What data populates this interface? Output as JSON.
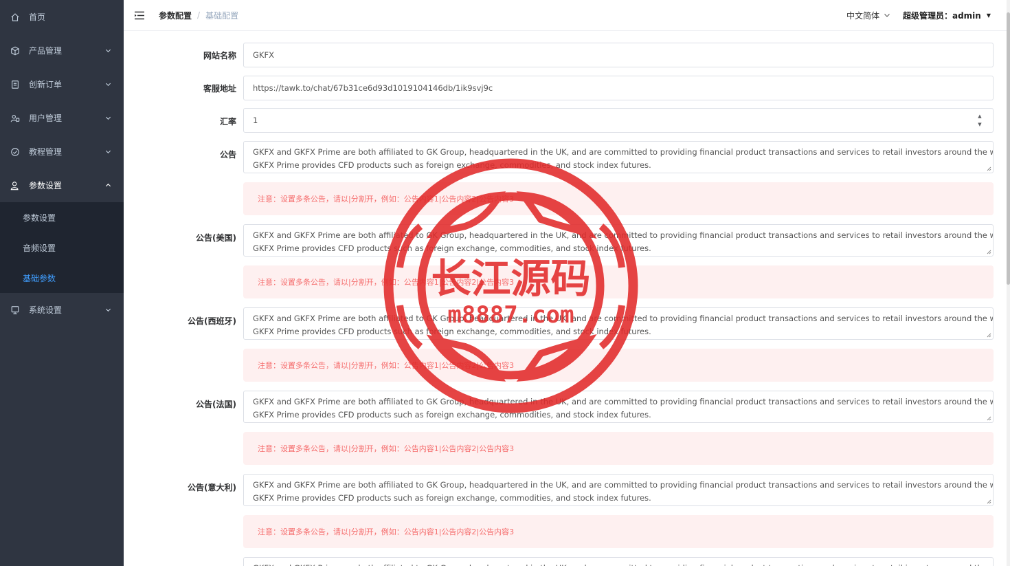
{
  "sidebar": {
    "items": [
      {
        "label": "首页",
        "icon": "home-icon",
        "has_arrow": false
      },
      {
        "label": "产品管理",
        "icon": "cube-icon",
        "has_arrow": true
      },
      {
        "label": "创新订单",
        "icon": "order-icon",
        "has_arrow": true
      },
      {
        "label": "用户管理",
        "icon": "users-icon",
        "has_arrow": true
      },
      {
        "label": "教程管理",
        "icon": "tutorial-icon",
        "has_arrow": true
      }
    ],
    "active_group": {
      "label": "参数设置",
      "icon": "user-settings-icon"
    },
    "sub_items": [
      {
        "label": "参数设置"
      },
      {
        "label": "音频设置"
      },
      {
        "label": "基础参数",
        "active": true
      }
    ],
    "after_items": [
      {
        "label": "系统设置",
        "icon": "monitor-icon",
        "has_arrow": true
      }
    ]
  },
  "header": {
    "breadcrumb": [
      "参数配置",
      "基础配置"
    ],
    "language": "中文简体",
    "user": "超级管理员：admin"
  },
  "form": {
    "site_name": {
      "label": "网站名称",
      "value": "GKFX"
    },
    "service_url": {
      "label": "客服地址",
      "value": "https://tawk.to/chat/67b31ce6d93d1019104146db/1ik9svj9c"
    },
    "rate": {
      "label": "汇率",
      "value": "1"
    },
    "announcement_text_line1": "GKFX and GKFX Prime are both affiliated to GK Group, headquartered in the UK, and are committed to providing financial product transactions and services to retail investors around the world.",
    "announcement_text_line2": "GKFX Prime provides CFD products such as foreign exchange, commodities, and stock index futures.",
    "notice_text": "注意：设置多条公告，请以|分割开，例如：公告内容1|公告内容2|公告内容3",
    "announcements": [
      {
        "label": "公告"
      },
      {
        "label": "公告(美国)"
      },
      {
        "label": "公告(西班牙)"
      },
      {
        "label": "公告(法国)"
      },
      {
        "label": "公告(意大利)"
      }
    ]
  },
  "watermark": {
    "text_main": "长江源码",
    "text_url": "m8887.com",
    "color": "#e22b2b"
  },
  "colors": {
    "sidebar_bg": "#2f3541",
    "submenu_bg": "#1f2530",
    "accent": "#409eff",
    "notice_bg": "#fef0f0",
    "notice_text": "#f56c6c"
  }
}
